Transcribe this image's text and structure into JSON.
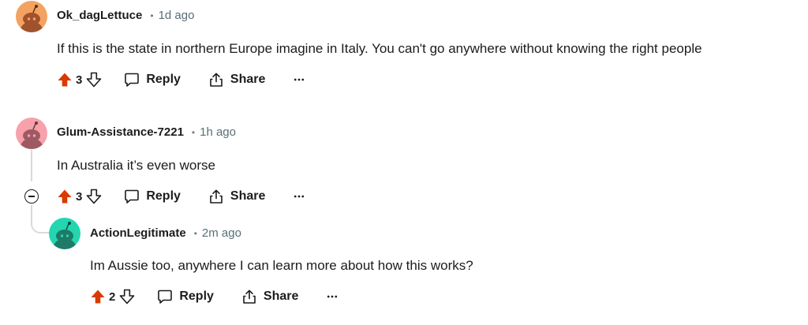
{
  "colors": {
    "upvote": "#d93a00",
    "avatar_orange": "#f4a261",
    "avatar_pink": "#f7a1ab",
    "avatar_teal": "#24d6b0"
  },
  "comments": [
    {
      "username": "Ok_dagLettuce",
      "separator": "•",
      "time": "1d ago",
      "body": "If this is the state in northern Europe imagine in Italy. You can't go anywhere without knowing the right people",
      "score": "3",
      "reply_label": "Reply",
      "share_label": "Share",
      "avatar_icon": "snoo-avatar-orange"
    },
    {
      "username": "Glum-Assistance-7221",
      "separator": "•",
      "time": "1h ago",
      "body": "In Australia it’s even worse",
      "score": "3",
      "reply_label": "Reply",
      "share_label": "Share",
      "avatar_icon": "snoo-avatar-pink"
    },
    {
      "username": "ActionLegitimate",
      "separator": "•",
      "time": "2m ago",
      "body": "Im Aussie too, anywhere I can learn more about how this works?",
      "score": "2",
      "reply_label": "Reply",
      "share_label": "Share",
      "avatar_icon": "snoo-avatar-teal"
    }
  ]
}
